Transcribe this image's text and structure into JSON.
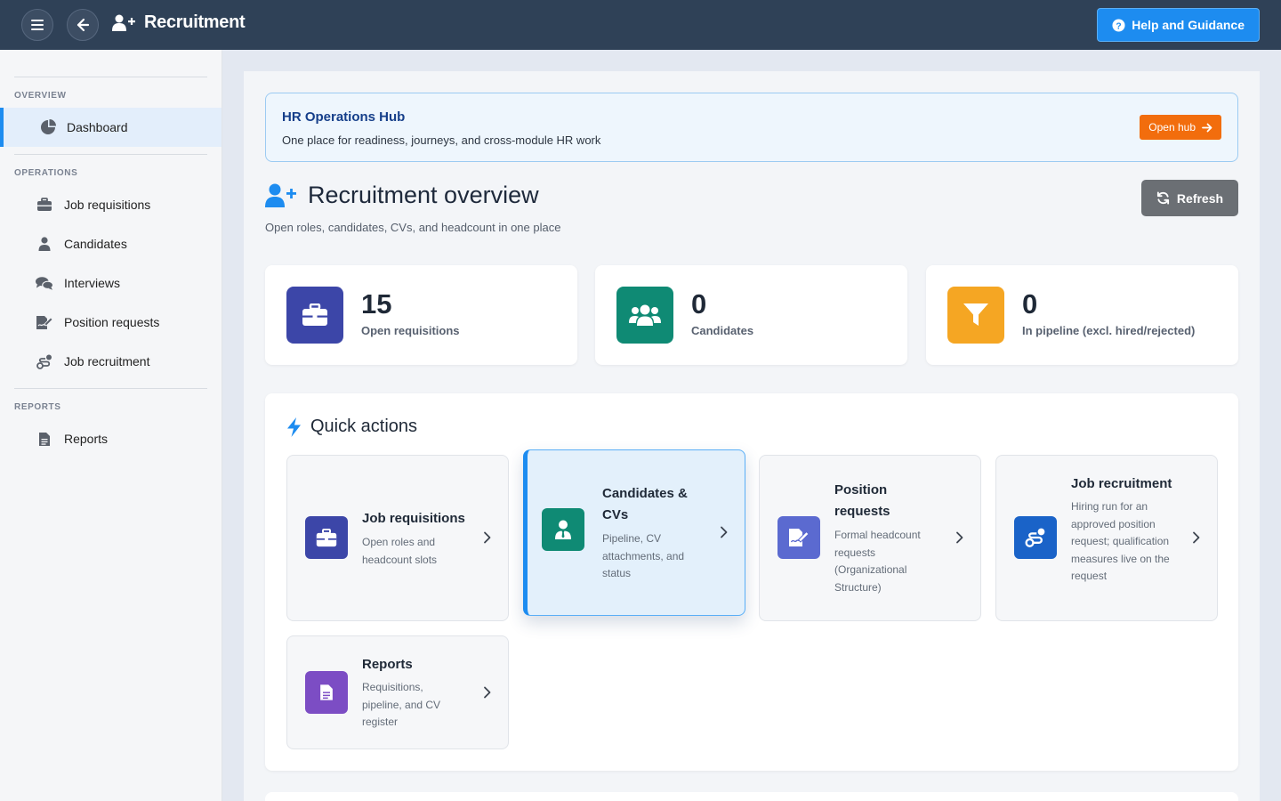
{
  "topbar": {
    "title": "Recruitment",
    "help_label": "Help and Guidance",
    "menu_icon": "hamburger-icon",
    "back_icon": "arrow-left-icon"
  },
  "sidebar": {
    "sections": {
      "overview": "OVERVIEW",
      "operations": "OPERATIONS",
      "reports": "REPORTS"
    },
    "items": [
      {
        "label": "Dashboard",
        "icon": "pie-chart-icon",
        "active": true
      },
      {
        "label": "Job requisitions",
        "icon": "briefcase-icon"
      },
      {
        "label": "Candidates",
        "icon": "user-tie-icon"
      },
      {
        "label": "Interviews",
        "icon": "comments-icon"
      },
      {
        "label": "Position requests",
        "icon": "file-signature-icon"
      },
      {
        "label": "Job recruitment",
        "icon": "route-icon"
      },
      {
        "label": "Reports",
        "icon": "file-alt-icon"
      }
    ]
  },
  "hub": {
    "title": "HR Operations Hub",
    "subtitle": "One place for readiness, journeys, and cross-module HR work",
    "button": "Open hub"
  },
  "overview": {
    "title": "Recruitment overview",
    "subtitle": "Open roles, candidates, CVs, and headcount in one place",
    "refresh": "Refresh"
  },
  "stats": [
    {
      "value": "15",
      "label": "Open requisitions",
      "icon": "briefcase-icon",
      "color": "#3c46a8"
    },
    {
      "value": "0",
      "label": "Candidates",
      "icon": "users-icon",
      "color": "#0f8a74"
    },
    {
      "value": "0",
      "label": "In pipeline (excl. hired/rejected)",
      "icon": "filter-icon",
      "color": "#f5a623"
    }
  ],
  "quick_actions": {
    "title": "Quick actions",
    "tiles": [
      {
        "title": "Job requisitions",
        "desc": "Open roles and headcount slots",
        "icon": "briefcase-icon",
        "color": "#3c46a8"
      },
      {
        "title": "Candidates & CVs",
        "desc": "Pipeline, CV attachments, and status",
        "icon": "user-tie-icon",
        "color": "#0f8a74",
        "active": true
      },
      {
        "title": "Position requests",
        "desc": "Formal headcount requests (Organizational Structure)",
        "icon": "file-signature-icon",
        "color": "#5b6ad0"
      },
      {
        "title": "Job recruitment",
        "desc": "Hiring run for an approved position request; qualification measures live on the request",
        "icon": "route-icon",
        "color": "#1a63c8"
      },
      {
        "title": "Reports",
        "desc": "Requisitions, pipeline, and CV register",
        "icon": "file-alt-icon",
        "color": "#7c4dc4"
      }
    ]
  }
}
